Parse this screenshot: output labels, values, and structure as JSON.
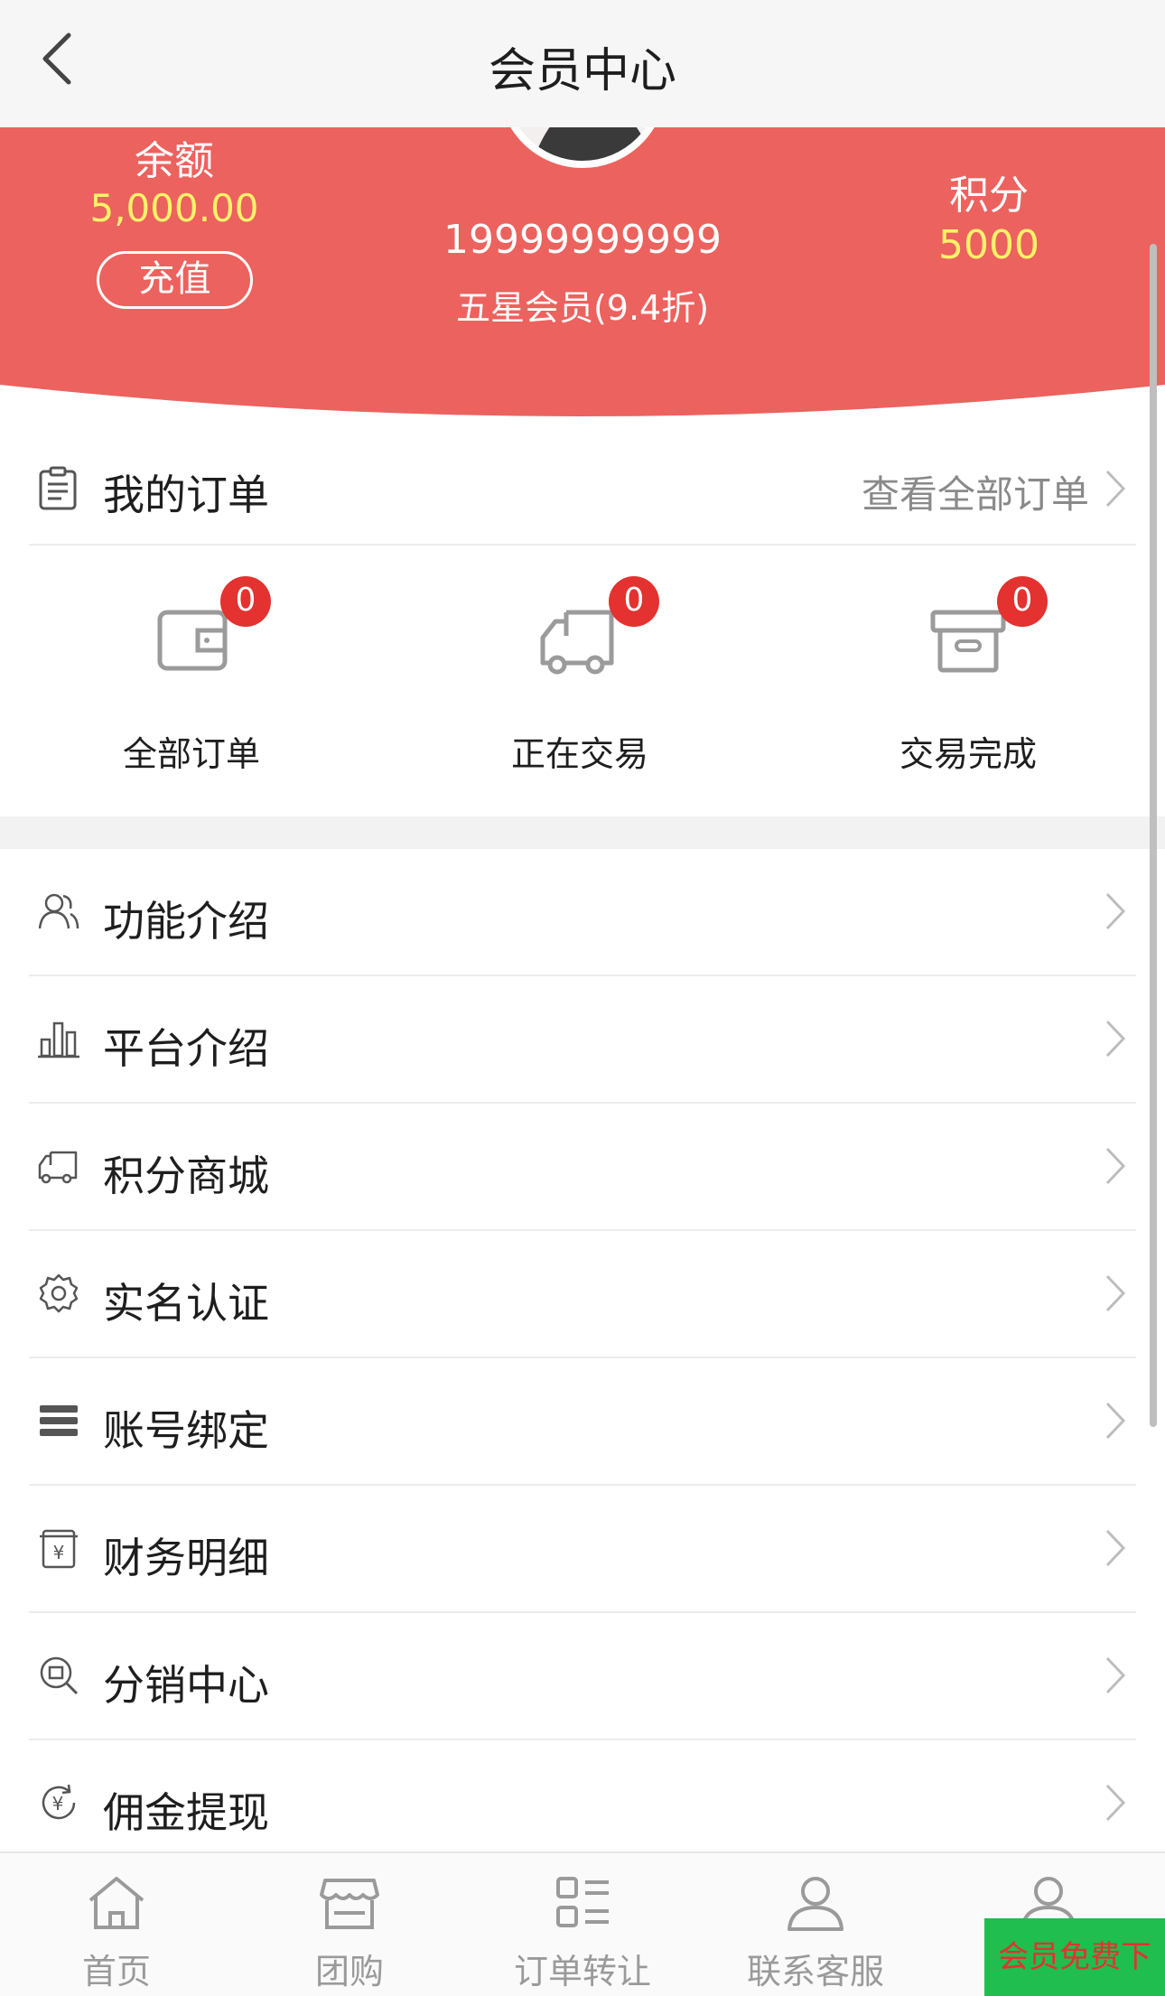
{
  "header": {
    "title": "会员中心"
  },
  "profile": {
    "balance_label": "余额",
    "balance_value": "5,000.00",
    "recharge_label": "充值",
    "phone": "19999999999",
    "level": "五星会员(9.4折)",
    "points_label": "积分",
    "points_value": "5000"
  },
  "orders": {
    "title": "我的订单",
    "view_all": "查看全部订单",
    "items": [
      {
        "label": "全部订单",
        "count": "0",
        "icon": "wallet-icon"
      },
      {
        "label": "正在交易",
        "count": "0",
        "icon": "truck-icon"
      },
      {
        "label": "交易完成",
        "count": "0",
        "icon": "archive-box-icon"
      }
    ]
  },
  "menu": [
    {
      "label": "功能介绍",
      "icon": "users-icon"
    },
    {
      "label": "平台介绍",
      "icon": "bar-chart-icon"
    },
    {
      "label": "积分商城",
      "icon": "truck-icon"
    },
    {
      "label": "实名认证",
      "icon": "gear-icon"
    },
    {
      "label": "账号绑定",
      "icon": "list-bars-icon"
    },
    {
      "label": "财务明细",
      "icon": "yuan-receipt-icon"
    },
    {
      "label": "分销中心",
      "icon": "search-shop-icon"
    },
    {
      "label": "佣金提现",
      "icon": "yuan-refresh-icon"
    }
  ],
  "tabbar": [
    {
      "label": "首页",
      "icon": "home-icon"
    },
    {
      "label": "团购",
      "icon": "store-icon"
    },
    {
      "label": "订单转让",
      "icon": "list-grid-icon"
    },
    {
      "label": "联系客服",
      "icon": "person-icon"
    },
    {
      "label": "",
      "icon": "person-icon"
    }
  ],
  "promo": {
    "label": "会员免费下载"
  },
  "colors": {
    "brand_red": "#ec625e",
    "badge_red": "#e3322f",
    "gold": "#fff26a",
    "promo_green": "#1fbe4e"
  }
}
